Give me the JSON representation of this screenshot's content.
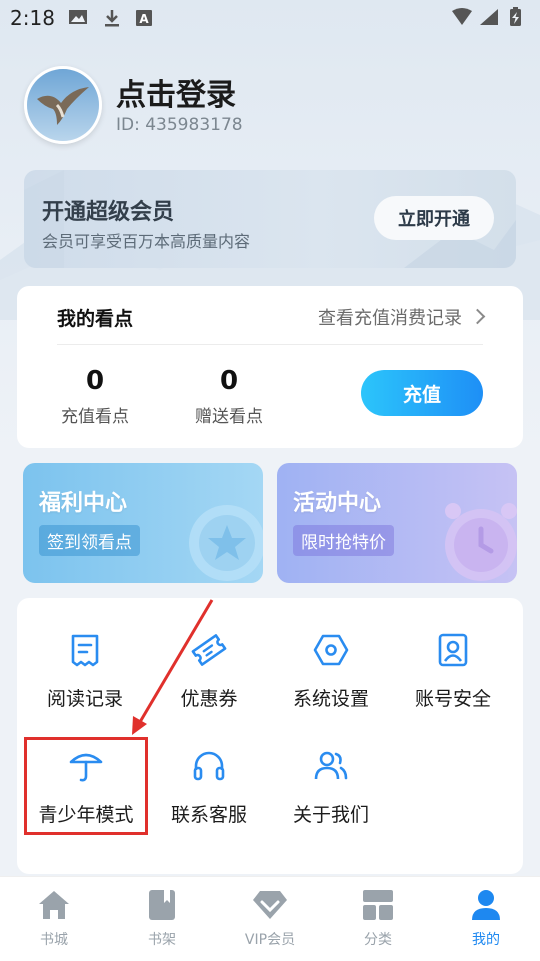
{
  "status_bar": {
    "time": "2:18"
  },
  "profile": {
    "name": "点击登录",
    "id_text": "ID: 435983178"
  },
  "vip_card": {
    "title": "开通超级会员",
    "subtitle": "会员可享受百万本高质量内容",
    "button": "立即开通"
  },
  "points": {
    "title": "我的看点",
    "link": "查看充值消费记录",
    "recharge_value": "0",
    "recharge_label": "充值看点",
    "gift_value": "0",
    "gift_label": "赠送看点",
    "button": "充值"
  },
  "promos": {
    "welfare": {
      "title": "福利中心",
      "tag": "签到领看点"
    },
    "activity": {
      "title": "活动中心",
      "tag": "限时抢特价"
    }
  },
  "menu": {
    "reading_history": "阅读记录",
    "coupons": "优惠券",
    "settings": "系统设置",
    "account_security": "账号安全",
    "teen_mode": "青少年模式",
    "customer_service": "联系客服",
    "about_us": "关于我们"
  },
  "tabs": {
    "bookstore": "书城",
    "bookshelf": "书架",
    "vip": "VIP会员",
    "category": "分类",
    "mine": "我的"
  },
  "colors": {
    "accent": "#1e88f0",
    "icon_blue": "#2a8cf0",
    "highlight": "#e0302c",
    "inactive": "#9aa3ab"
  }
}
